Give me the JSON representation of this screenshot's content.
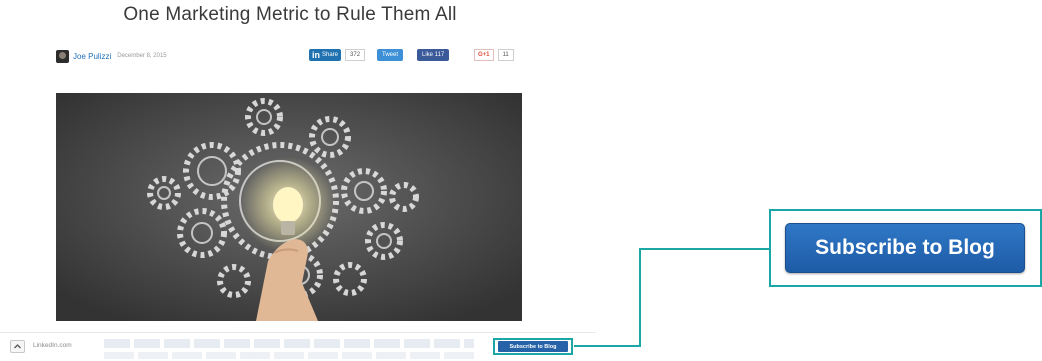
{
  "article": {
    "title": "One Marketing Metric to Rule Them All",
    "author": "Joe Pulizzi",
    "date": "December 8, 2015",
    "hero_image": "lightbulb-gears-illustration"
  },
  "share_bar": {
    "linkedin_label": "Share",
    "linkedin_icon": "in",
    "linkedin_count": "372",
    "twitter_label": "Tweet",
    "facebook_label": "Like 117",
    "gplus_label": "G+1",
    "gplus_count": "11"
  },
  "footer": {
    "site": "LinkedIn.com",
    "subscribe_label": "Subscribe to Blog"
  },
  "callout": {
    "subscribe_label": "Subscribe to Blog"
  },
  "colors": {
    "accent_teal": "#1aa7a5",
    "subscribe_blue": "#2562a8",
    "linkedin_blue": "#2071b0"
  }
}
